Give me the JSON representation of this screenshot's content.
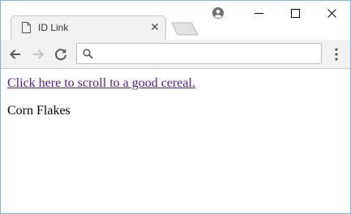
{
  "browser": {
    "tab": {
      "title": "ID Link"
    },
    "address_bar": {
      "value": "",
      "placeholder": ""
    },
    "colors": {
      "frame_border": "#7eb4ea",
      "link_visited": "#551a8b",
      "toolbar_bg": "#f2f2f2"
    }
  },
  "page": {
    "link_text": "Click here to scroll to a good cereal.",
    "paragraph": "Corn Flakes"
  }
}
